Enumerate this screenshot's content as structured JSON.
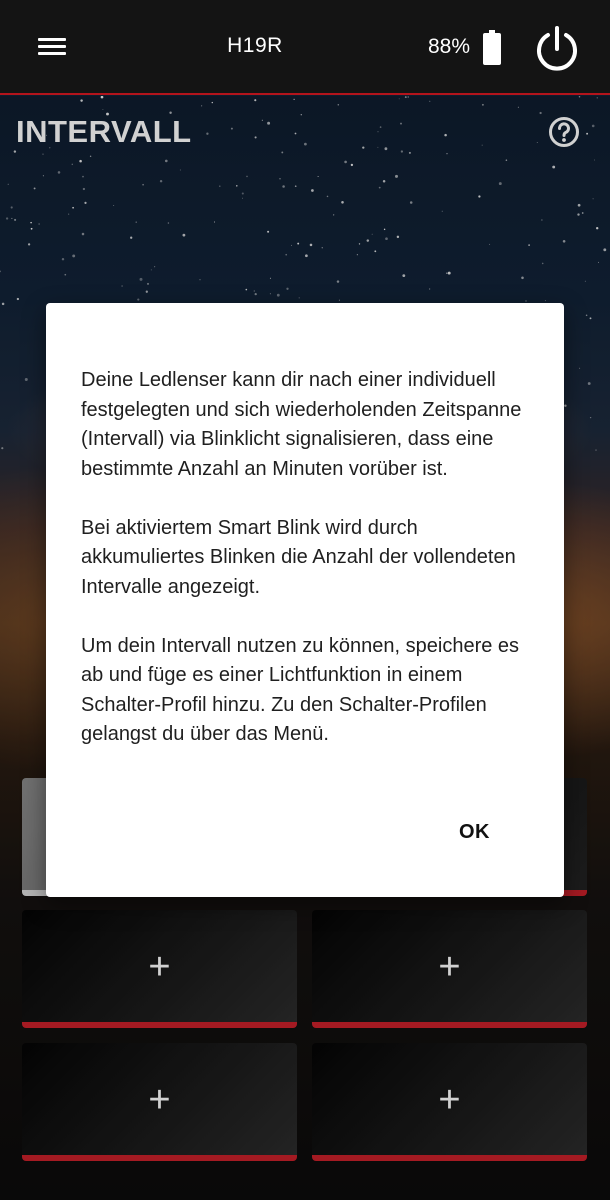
{
  "header": {
    "device_name": "H19R",
    "battery_percent": "88%"
  },
  "page": {
    "title": "INTERVALL"
  },
  "tiles": [
    {
      "label": "+"
    },
    {
      "label": "+"
    },
    {
      "label": "+"
    },
    {
      "label": "+"
    }
  ],
  "dialog": {
    "paragraphs": [
      "Deine Ledlenser kann dir nach einer individuell festgelegten und sich wiederholenden Zeitspanne (Intervall) via Blinklicht signalisieren, dass eine bestimmte Anzahl an Minuten vorüber ist.",
      "Bei aktiviertem Smart Blink wird durch akkumuliertes Blinken die Anzahl der vollendeten Intervalle angezeigt.",
      "Um dein Intervall nutzen zu können, speichere es ab und füge es einer Lichtfunktion in einem Schalter-Profil hinzu. Zu den Schalter-Profilen gelangst du über das Menü."
    ],
    "ok_label": "OK"
  },
  "icons": {
    "menu": "menu-icon",
    "battery": "battery-icon",
    "power": "power-icon",
    "help": "help-icon",
    "plus": "plus-icon"
  },
  "colors": {
    "accent": "#c9202a",
    "topbar": "#141414",
    "dialog_bg": "#ffffff"
  }
}
